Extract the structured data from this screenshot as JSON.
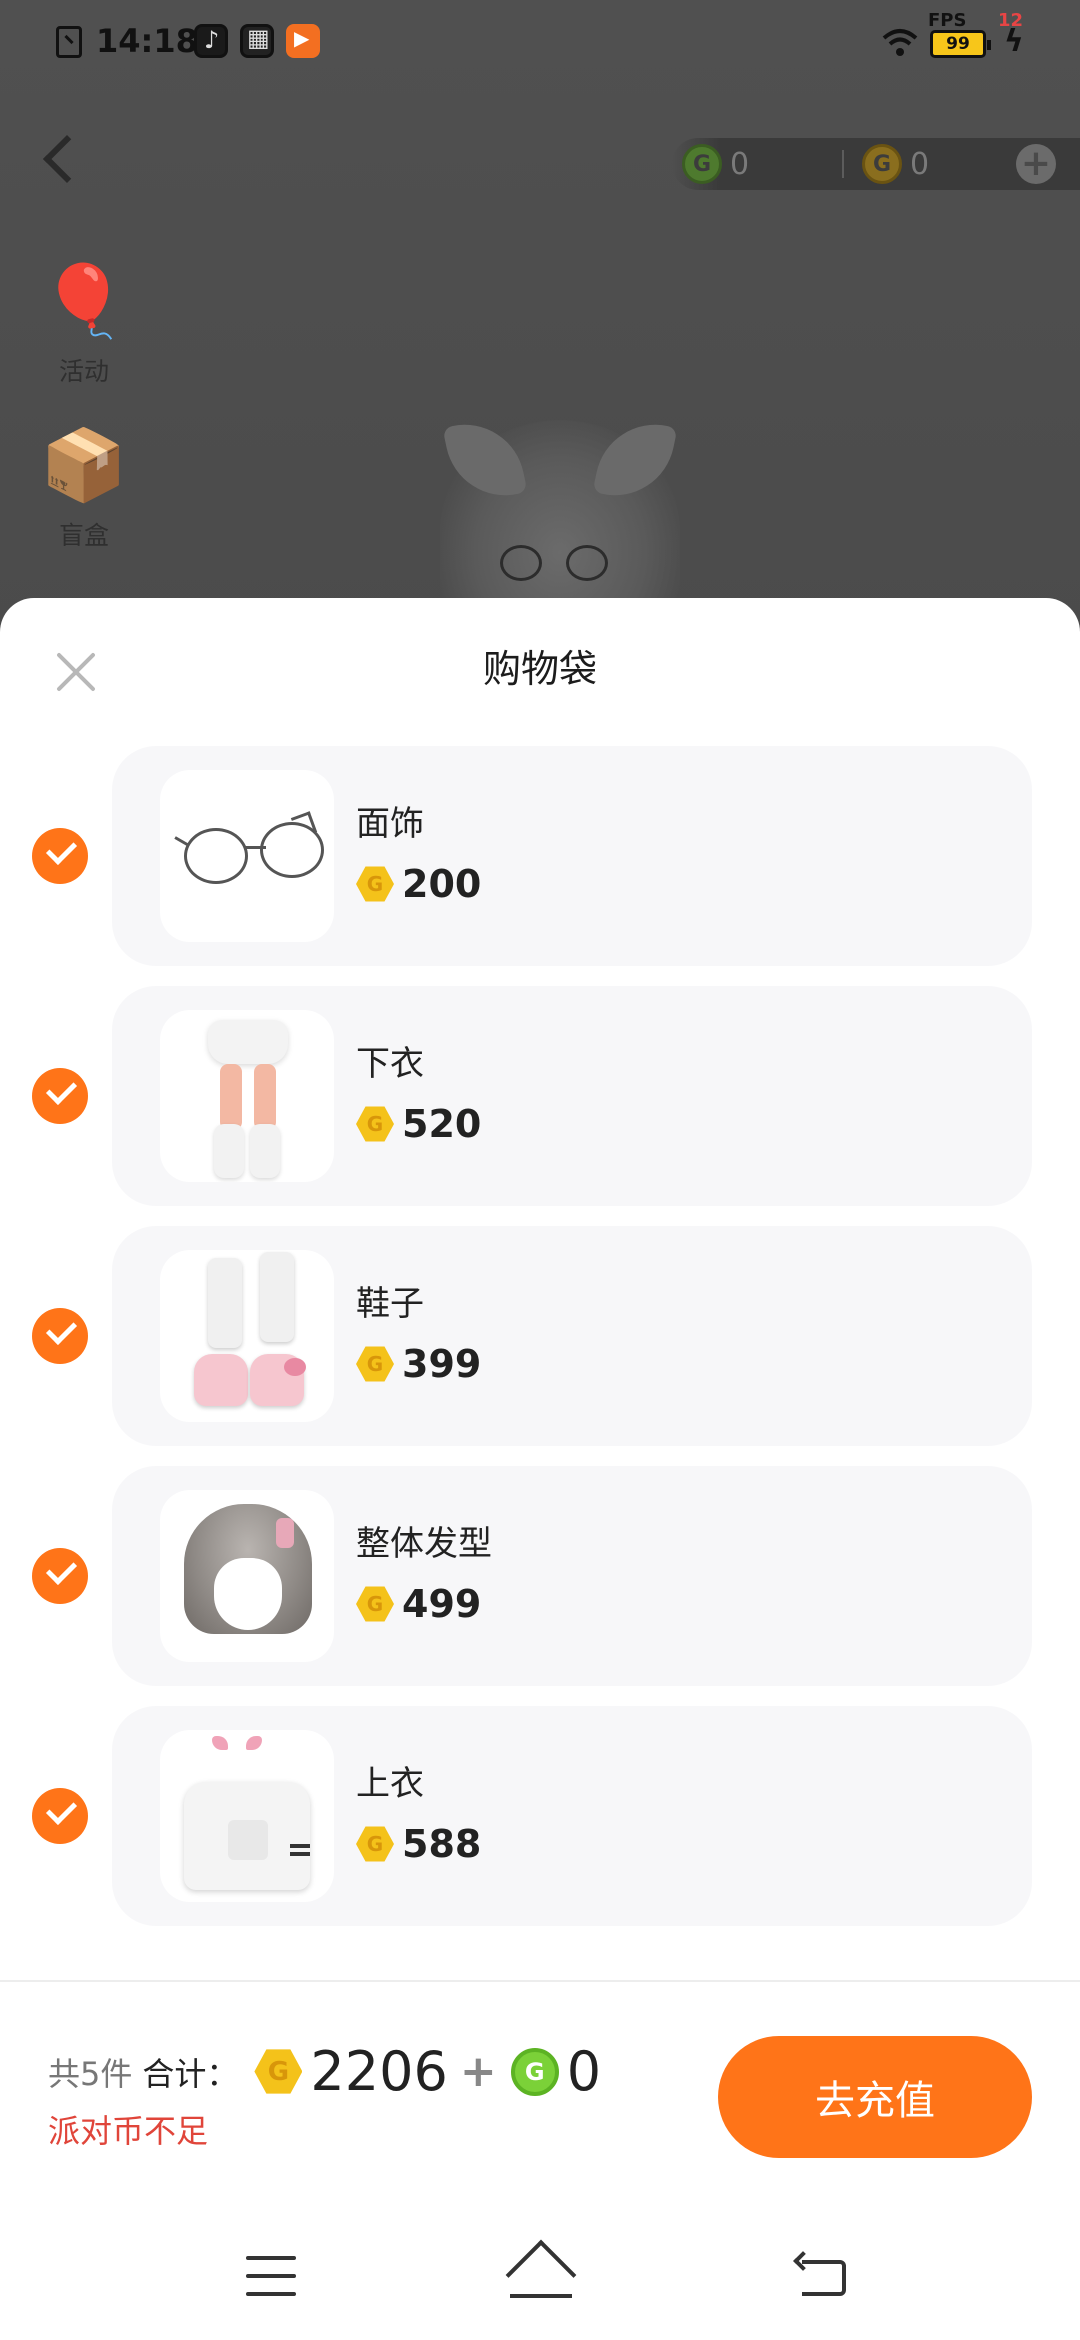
{
  "status_bar": {
    "time": "14:18",
    "fps_label": "FPS",
    "fps_value": "12",
    "battery": "99"
  },
  "currency": {
    "green_coin_value": "0",
    "gold_coin_value": "0"
  },
  "side_buttons": [
    {
      "label": "活动",
      "icon": "hot-air-balloon-icon"
    },
    {
      "label": "盲盒",
      "icon": "blind-box-icon"
    }
  ],
  "sheet": {
    "title": "购物袋"
  },
  "cart_items": [
    {
      "name": "面饰",
      "price": "200",
      "checked": true
    },
    {
      "name": "下衣",
      "price": "520",
      "checked": true
    },
    {
      "name": "鞋子",
      "price": "399",
      "checked": true
    },
    {
      "name": "整体发型",
      "price": "499",
      "checked": true
    },
    {
      "name": "上衣",
      "price": "588",
      "checked": true
    }
  ],
  "summary": {
    "count_text": "共5件",
    "total_label": "合计：",
    "gold_total": "2206",
    "plus": "+",
    "green_total": "0",
    "warning": "派对币不足",
    "recharge_label": "去充值"
  },
  "colors": {
    "accent": "#ff7418",
    "warning": "#e0453a",
    "gold_coin": "#f4c21a",
    "green_coin": "#7bd138"
  }
}
